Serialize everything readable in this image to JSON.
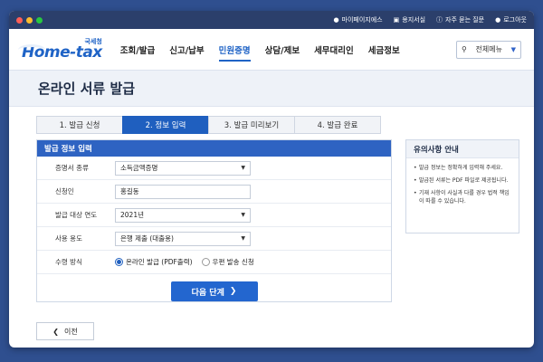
{
  "titlebar": {
    "dots": [
      "#ff5f57",
      "#febc2e",
      "#28c840"
    ],
    "links": [
      {
        "icon": "person-icon",
        "label": "마이페이지에스"
      },
      {
        "icon": "document-icon",
        "label": "용지서실"
      },
      {
        "icon": "help-icon",
        "label": "자주 묻는 질문"
      },
      {
        "icon": "person-icon",
        "label": "로그아웃"
      }
    ]
  },
  "header": {
    "logo_small": "국세청",
    "logo_big": "Home-tax",
    "nav": [
      "조회/발급",
      "신고/납부",
      "민원증명",
      "상담/제보",
      "세무대리인",
      "세금정보"
    ],
    "active_nav": "민원증명",
    "allmenu_label": "전체메뉴"
  },
  "page": {
    "title": "온라인 서류 발급",
    "steps": [
      "1. 발급 신청",
      "2. 정보 입력",
      "3. 발급 미리보기",
      "4. 발급 완료"
    ],
    "active_step": 1
  },
  "form": {
    "heading": "발급 정보 입력",
    "fields": [
      {
        "label": "증명서 종류",
        "value": "소득금액증명",
        "type": "select"
      },
      {
        "label": "신청인",
        "value": "홍길동",
        "type": "text"
      },
      {
        "label": "발급 대상 연도",
        "value": "2021년",
        "type": "select"
      },
      {
        "label": "사용 용도",
        "value": "은행 제출 (대출용)",
        "type": "select"
      }
    ],
    "receive_label": "수령 방식",
    "receive_options": [
      "온라인 발급 (PDF출력)",
      "우편 발송 신청"
    ],
    "receive_selected": 0,
    "next_label": "다음 단계"
  },
  "notice": {
    "heading": "유의사항 안내",
    "items": [
      "발급 정보는 정확하게 입력해 주세요.",
      "발급된 서류는 PDF 파일로 제공됩니다.",
      "기재 사항이 사실과 다를 경우 법적 책임이 따를 수 있습니다."
    ]
  },
  "footer": {
    "prev_label": "이전"
  }
}
